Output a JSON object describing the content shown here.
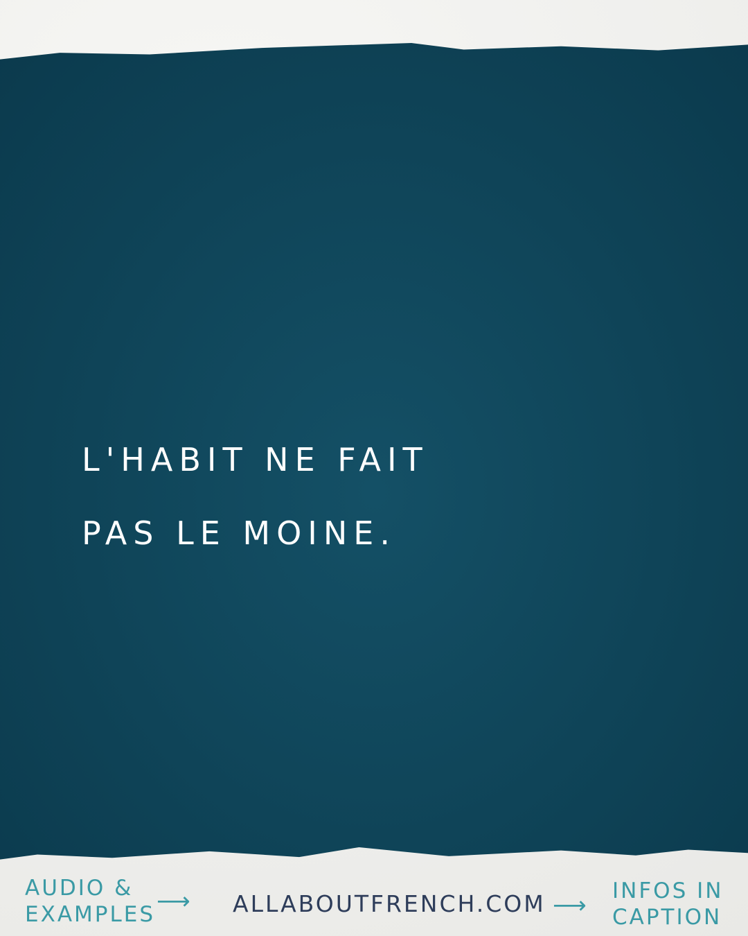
{
  "quote": {
    "line1": "L'HABIT NE FAIT",
    "line2": "PAS LE MOINE."
  },
  "footer": {
    "left_line1": "AUDIO &",
    "left_line2": "EXAMPLES",
    "site": "ALLABOUTFRENCH.COM",
    "right_line1": "INFOS IN",
    "right_line2": "CAPTION"
  },
  "colors": {
    "panel": "#0f4458",
    "accent": "#3a9aa5",
    "site": "#2e3d5a"
  }
}
